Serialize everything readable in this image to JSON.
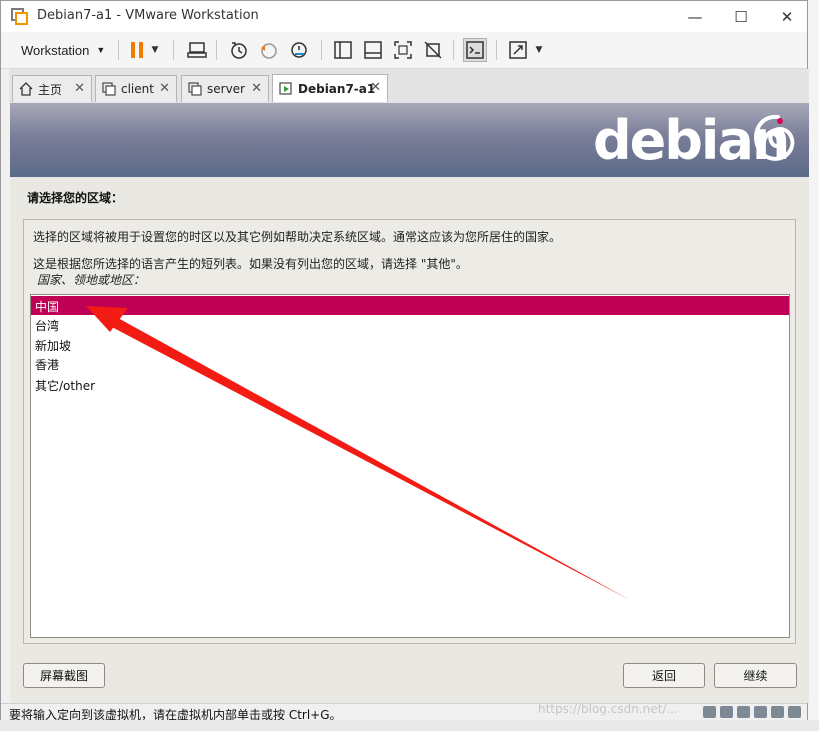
{
  "window": {
    "title": "Debian7-a1 - VMware Workstation",
    "minimize": "—",
    "maximize": "☐",
    "close": "✕"
  },
  "toolbar": {
    "menu_label": "Workstation",
    "menu_caret": "▼"
  },
  "tabs": [
    {
      "label": "主页",
      "icon": "home-icon",
      "close": "✕"
    },
    {
      "label": "client",
      "icon": "vm-icon",
      "close": "✕"
    },
    {
      "label": "server",
      "icon": "vm-icon",
      "close": "✕"
    },
    {
      "label": "Debian7-a1",
      "icon": "vm-running-icon",
      "close": "✕"
    }
  ],
  "installer": {
    "brand": "debian",
    "heading": "请选择您的区域：",
    "desc1": "选择的区域将被用于设置您的时区以及其它例如帮助决定系统区域。通常这应该为您所居住的国家。",
    "desc2": "这是根据您所选择的语言产生的短列表。如果没有列出您的区域，请选择 \"其他\"。",
    "list_label": "国家、领地或地区：",
    "options": [
      "中国",
      "台湾",
      "新加坡",
      "香港",
      "其它/other"
    ],
    "selected": "中国",
    "screenshot_button": "屏幕截图",
    "back_button": "返回",
    "continue_button": "继续",
    "accent_color": "#c00055"
  },
  "status": {
    "message": "要将输入定向到该虚拟机，请在虚拟机内部单击或按 Ctrl+G。",
    "watermark": "https://blog.csdn.net/..."
  }
}
